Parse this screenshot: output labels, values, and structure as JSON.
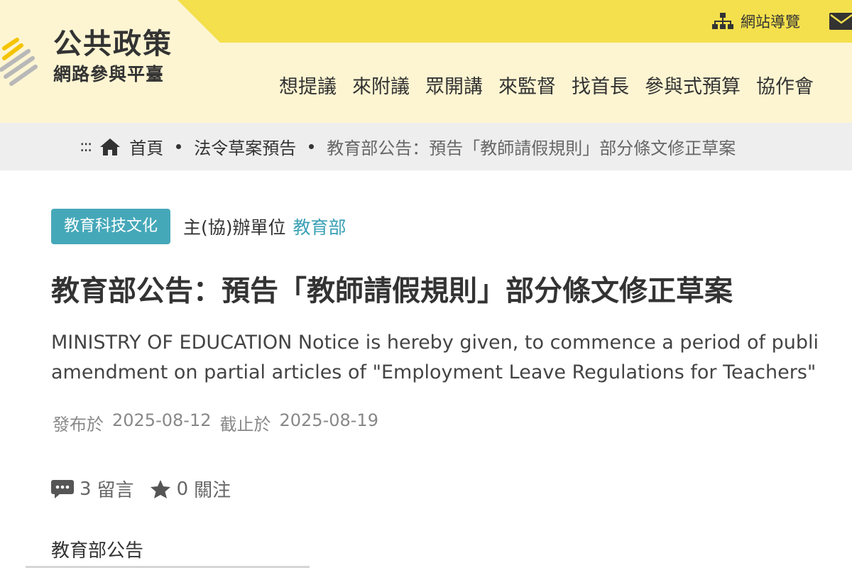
{
  "header": {
    "logo_title": "公共政策",
    "logo_subtitle": "網路參與平臺",
    "sitemap_label": "網站導覽",
    "mail_icon": "mail-icon",
    "colors": {
      "header_bg": "#fdf5d2",
      "topbar": "#f4e04d"
    }
  },
  "nav": {
    "items": [
      {
        "label": "想提議"
      },
      {
        "label": "來附議"
      },
      {
        "label": "眾開講"
      },
      {
        "label": "來監督"
      },
      {
        "label": "找首長"
      },
      {
        "label": "參與式預算"
      },
      {
        "label": "協作會"
      }
    ]
  },
  "breadcrumb": {
    "dots": ":::",
    "home": "首頁",
    "section": "法令草案預告",
    "current": "教育部公告：預告「教師請假規則」部分條文修正草案"
  },
  "article": {
    "category": "教育科技文化",
    "organizer_label": "主(協)辦單位",
    "organizer": "教育部",
    "title": "教育部公告：預告「教師請假規則」部分條文修正草案",
    "english_line1": "MINISTRY OF EDUCATION Notice is hereby given, to commence a period of publi",
    "english_line2": "amendment on partial articles of \"Employment Leave Regulations for Teachers\"",
    "published_label": "發布於",
    "published_date": "2025-08-12",
    "deadline_label": "截止於",
    "deadline_date": "2025-08-19",
    "comments_count": "3",
    "comments_label": "留言",
    "follows_count": "0",
    "follows_label": "關注",
    "body_heading": "教育部公告",
    "colors": {
      "badge": "#45a8b9",
      "link": "#3aa0b5"
    }
  }
}
